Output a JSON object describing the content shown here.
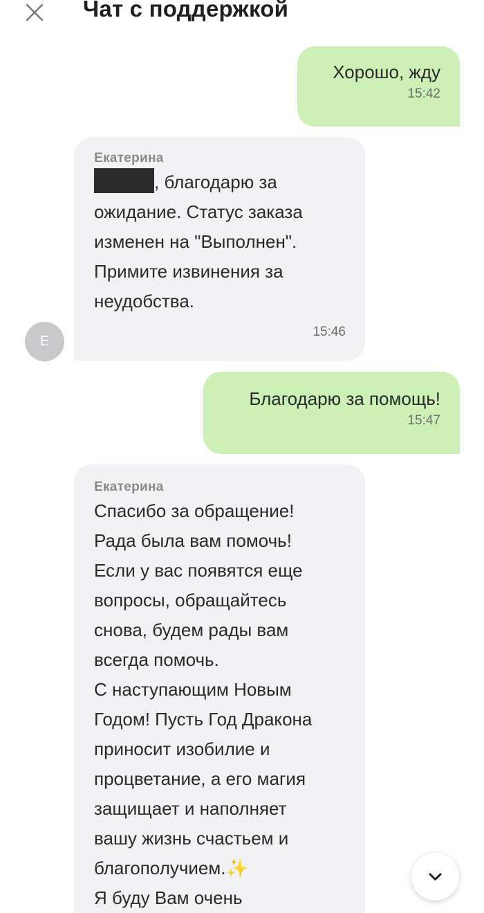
{
  "header": {
    "title": "Чат с поддержкой",
    "close_icon": "close-icon"
  },
  "messages": [
    {
      "direction": "outgoing",
      "text": "Хорошо, жду",
      "time": "15:42"
    },
    {
      "direction": "incoming",
      "sender": "Екатерина",
      "text_after_redaction": ", благодарю за\nожидание. Статус заказа\nизменен на \"Выполнен\".\nПримите извинения за\nнеудобства.",
      "time": "15:46",
      "avatar_letter": "Е"
    },
    {
      "direction": "outgoing",
      "text": "Благодарю за помощь!",
      "time": "15:47"
    },
    {
      "direction": "incoming",
      "sender": "Екатерина",
      "text": "Спасибо за обращение!\nРада была вам помочь!\nЕсли у вас появятся еще\nвопросы, обращайтесь\nснова, будем рады вам\nвсегда помочь.\nС наступающим Новым\nГодом! Пусть Год Дракона\nприносит изобилие и\nпроцветание, а его магия\nзащищает и наполняет\nвашу жизнь счастьем и\nблагополучием.✨\nЯ буду Вам очень"
    }
  ],
  "scroll_button": {
    "icon": "chevron-down-icon"
  },
  "colors": {
    "outgoing_bubble": "#cdf0b7",
    "incoming_bubble": "#f2f2f4",
    "avatar": "#c9c9cb"
  }
}
